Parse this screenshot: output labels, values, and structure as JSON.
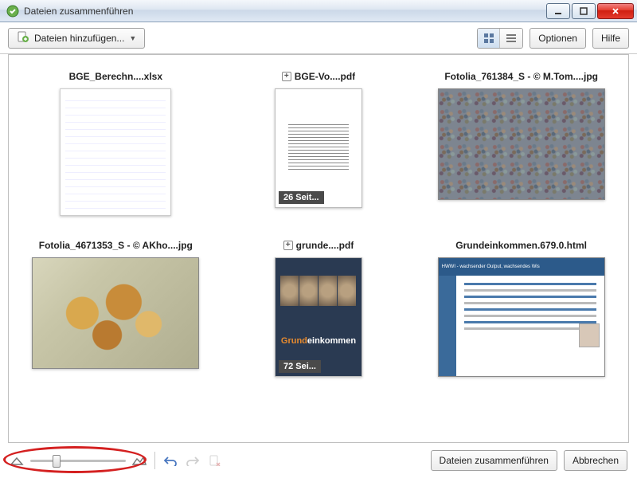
{
  "window": {
    "title": "Dateien zusammenführen"
  },
  "toolbar": {
    "add_files": "Dateien hinzufügen...",
    "options": "Optionen",
    "help": "Hilfe"
  },
  "files": [
    {
      "name": "BGE_Berechn....xlsx",
      "type": "xlsx"
    },
    {
      "name": "BGE-Vo....pdf",
      "type": "pdf",
      "pages_label": "26 Seit..."
    },
    {
      "name": "Fotolia_761384_S - © M.Tom....jpg",
      "type": "photo_crowd"
    },
    {
      "name": "Fotolia_4671353_S - © AKho....jpg",
      "type": "photo_coins"
    },
    {
      "name": "grunde....pdf",
      "type": "pdf_dark",
      "pages_label": "72 Sei...",
      "brand_a": "Grund",
      "brand_b": "einkommen"
    },
    {
      "name": "Grundeinkommen.679.0.html",
      "type": "html",
      "banner": "HWWI - wachsender Output, wachsendes Wis"
    }
  ],
  "footer": {
    "merge": "Dateien zusammenführen",
    "cancel": "Abbrechen"
  }
}
